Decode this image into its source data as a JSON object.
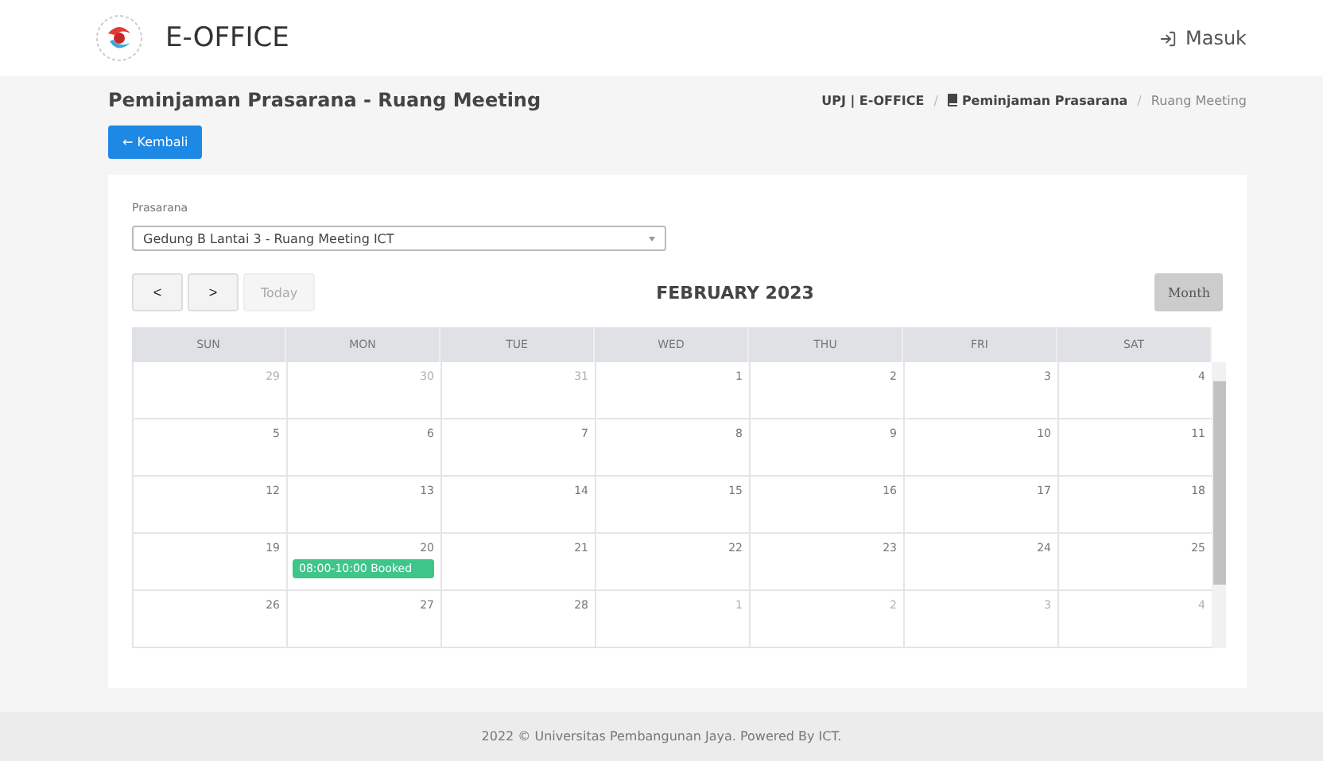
{
  "header": {
    "app_name": "E-OFFICE",
    "login": "Masuk"
  },
  "page": {
    "title": "Peminjaman Prasarana - Ruang Meeting",
    "back_button": "← Kembali",
    "breadcrumb": {
      "separator": "/",
      "items": [
        {
          "label": "UPJ | E-OFFICE",
          "kind": "link"
        },
        {
          "label": "Peminjaman Prasarana",
          "kind": "section"
        },
        {
          "label": "Ruang Meeting",
          "kind": "current"
        }
      ]
    }
  },
  "form": {
    "label": "Prasarana",
    "value": "Gedung B Lantai 3 - Ruang Meeting ICT"
  },
  "calendar": {
    "prev": "<",
    "next": ">",
    "today": {
      "label": "Today",
      "disabled": true
    },
    "title": "FEBRUARY 2023",
    "view_button": "Month",
    "weekdays": [
      "SUN",
      "MON",
      "TUE",
      "WED",
      "THU",
      "FRI",
      "SAT"
    ],
    "weeks": [
      [
        {
          "day": "29",
          "other": true
        },
        {
          "day": "30",
          "other": true
        },
        {
          "day": "31",
          "other": true
        },
        {
          "day": "1",
          "other": false
        },
        {
          "day": "2",
          "other": false
        },
        {
          "day": "3",
          "other": false
        },
        {
          "day": "4",
          "other": false
        }
      ],
      [
        {
          "day": "5",
          "other": false
        },
        {
          "day": "6",
          "other": false
        },
        {
          "day": "7",
          "other": false
        },
        {
          "day": "8",
          "other": false
        },
        {
          "day": "9",
          "other": false
        },
        {
          "day": "10",
          "other": false
        },
        {
          "day": "11",
          "other": false
        }
      ],
      [
        {
          "day": "12",
          "other": false
        },
        {
          "day": "13",
          "other": false
        },
        {
          "day": "14",
          "other": false
        },
        {
          "day": "15",
          "other": false
        },
        {
          "day": "16",
          "other": false
        },
        {
          "day": "17",
          "other": false
        },
        {
          "day": "18",
          "other": false
        }
      ],
      [
        {
          "day": "19",
          "other": false
        },
        {
          "day": "20",
          "other": false,
          "events": [
            {
              "label": "08:00-10:00 Booked",
              "color": "#3ec58a"
            }
          ]
        },
        {
          "day": "21",
          "other": false
        },
        {
          "day": "22",
          "other": false
        },
        {
          "day": "23",
          "other": false
        },
        {
          "day": "24",
          "other": false
        },
        {
          "day": "25",
          "other": false
        }
      ],
      [
        {
          "day": "26",
          "other": false
        },
        {
          "day": "27",
          "other": false
        },
        {
          "day": "28",
          "other": false
        },
        {
          "day": "1",
          "other": true
        },
        {
          "day": "2",
          "other": true
        },
        {
          "day": "3",
          "other": true
        },
        {
          "day": "4",
          "other": true
        }
      ]
    ]
  },
  "footer": "2022 © Universitas Pembangunan Jaya. Powered By ICT."
}
